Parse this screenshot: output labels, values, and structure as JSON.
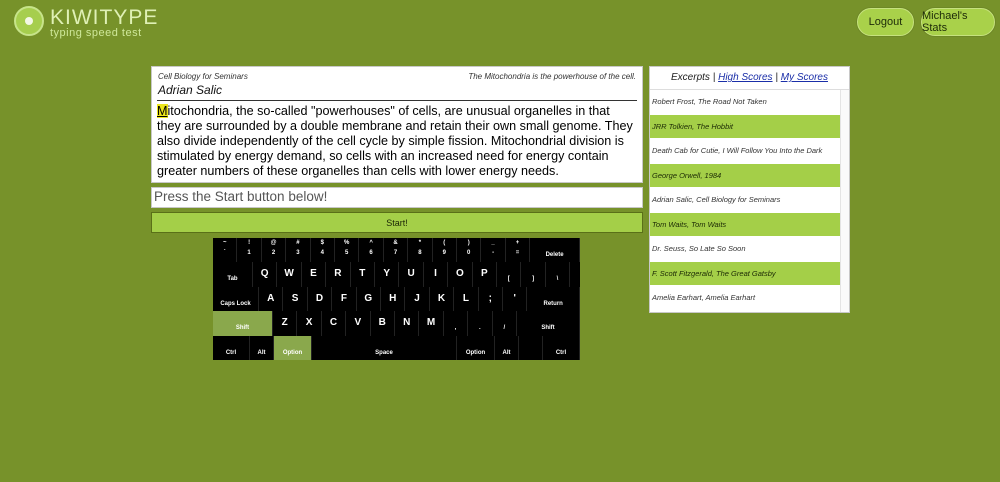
{
  "header": {
    "brand": "KIWITYPE",
    "tagline": "typing speed test",
    "logout_label": "Logout",
    "stats_label": "Michael's Stats"
  },
  "excerpt": {
    "course": "Cell Biology for Seminars",
    "quote": "The Mitochondria is the powerhouse of the cell.",
    "author": "Adrian Salic",
    "current_char": "M",
    "passage_rest": "itochondria, the so-called \"powerhouses\" of cells, are unusual organelles in that they are surrounded by a double membrane and retain their own small genome. They also divide independently of the cell cycle by simple fission. Mitochondrial division is stimulated by energy demand, so cells with an increased need for energy contain greater numbers of these organelles than cells with lower energy needs."
  },
  "typing": {
    "prompt": "Press the Start button below!",
    "start_label": "Start!"
  },
  "keyboard": {
    "number_row": [
      {
        "top": "~",
        "bottom": "`"
      },
      {
        "top": "!",
        "bottom": "1"
      },
      {
        "top": "@",
        "bottom": "2"
      },
      {
        "top": "#",
        "bottom": "3"
      },
      {
        "top": "$",
        "bottom": "4"
      },
      {
        "top": "%",
        "bottom": "5"
      },
      {
        "top": "^",
        "bottom": "6"
      },
      {
        "top": "&",
        "bottom": "7"
      },
      {
        "top": "*",
        "bottom": "8"
      },
      {
        "top": "(",
        "bottom": "9"
      },
      {
        "top": ")",
        "bottom": "0"
      },
      {
        "top": "_",
        "bottom": "-"
      },
      {
        "top": "+",
        "bottom": "="
      }
    ],
    "delete": "Delete",
    "tab": "Tab",
    "qwerty_row": [
      "Q",
      "W",
      "E",
      "R",
      "T",
      "Y",
      "U",
      "I",
      "O",
      "P",
      "[",
      "]",
      "\\"
    ],
    "caps": "Caps Lock",
    "home_row": [
      "A",
      "S",
      "D",
      "F",
      "G",
      "H",
      "J",
      "K",
      "L",
      ";",
      "'"
    ],
    "return": "Return",
    "shift": "Shift",
    "bottom_row": [
      "Z",
      "X",
      "C",
      "V",
      "B",
      "N",
      "M",
      ",",
      ".",
      "/"
    ],
    "ctrl": "Ctrl",
    "alt": "Alt",
    "option": "Option",
    "space": "Space",
    "highlighted_keys": [
      "left-shift",
      "left-option"
    ]
  },
  "sidebar": {
    "tab_excerpts": "Excerpts",
    "separator": "|",
    "tab_high_scores": "High Scores",
    "tab_my_scores": "My Scores",
    "items": [
      "Robert Frost, The Road Not Taken",
      "JRR Tolkien, The Hobbit",
      "Death Cab for Cutie, I Will Follow You Into the Dark",
      "George Orwell, 1984",
      "Adrian Salic, Cell Biology for Seminars",
      "Tom Waits, Tom Waits",
      "Dr. Seuss, So Late So Soon",
      "F. Scott Fitzgerald, The Great Gatsby",
      "Amelia Earhart, Amelia Earhart"
    ]
  },
  "colors": {
    "background": "#77922a",
    "accent": "#a4cf48",
    "highlight": "#ece61c",
    "key_active": "#8aa84c"
  }
}
